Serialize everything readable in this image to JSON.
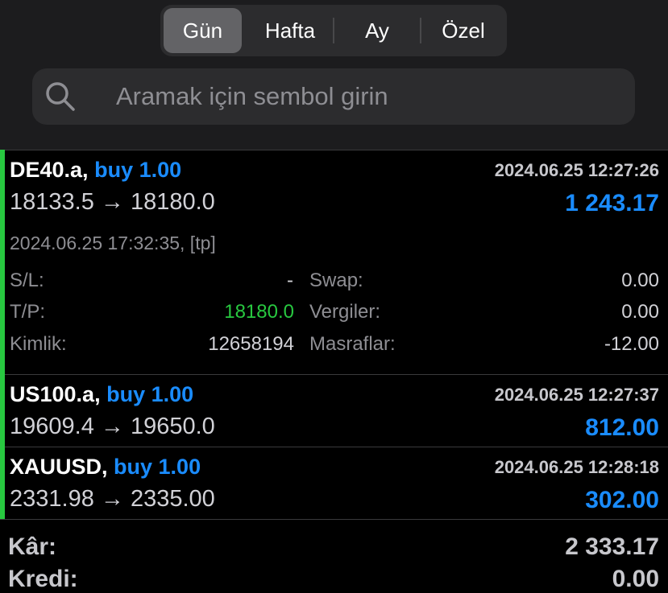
{
  "period_tabs": [
    {
      "label": "Gün",
      "active": true
    },
    {
      "label": "Hafta",
      "active": false
    },
    {
      "label": "Ay",
      "active": false
    },
    {
      "label": "Özel",
      "active": false
    }
  ],
  "search": {
    "placeholder": "Aramak için sembol girin",
    "icon": "search-icon"
  },
  "orders": [
    {
      "symbol": "DE40.a,",
      "side": "buy 1.00",
      "open_time": "2024.06.25 12:27:26",
      "prices": "18133.5 → 18180.0",
      "profit": "1 243.17",
      "close_info": "2024.06.25 17:32:35, [tp]",
      "details": {
        "sl_label": "S/L:",
        "sl_value": "-",
        "tp_label": "T/P:",
        "tp_value": "18180.0",
        "id_label": "Kimlik:",
        "id_value": "12658194",
        "swap_label": "Swap:",
        "swap_value": "0.00",
        "taxes_label": "Vergiler:",
        "taxes_value": "0.00",
        "fees_label": "Masraflar:",
        "fees_value": "-12.00"
      }
    },
    {
      "symbol": "US100.a,",
      "side": "buy 1.00",
      "open_time": "2024.06.25 12:27:37",
      "prices": "19609.4 → 19650.0",
      "profit": "812.00"
    },
    {
      "symbol": "XAUUSD,",
      "side": "buy 1.00",
      "open_time": "2024.06.25 12:28:18",
      "prices": "2331.98 → 2335.00",
      "profit": "302.00"
    }
  ],
  "summary": {
    "profit_label": "Kâr:",
    "profit_value": "2 333.17",
    "credit_label": "Kredi:",
    "credit_value": "0.00"
  },
  "colors": {
    "accent_blue": "#1a8cff",
    "accent_green": "#28c840",
    "background": "#000000"
  }
}
